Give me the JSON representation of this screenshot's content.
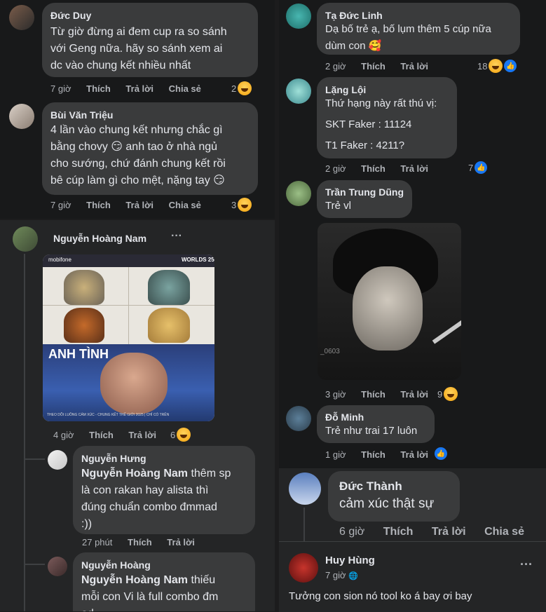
{
  "actions": {
    "like": "Thích",
    "reply": "Trả lời",
    "share": "Chia sẻ"
  },
  "left_top": [
    {
      "name": "Đức Duy",
      "lines": [
        "Từ giờ đừng ai đem cup ra so sánh",
        "với Geng nữa. hãy so sánh xem ai",
        "dc vào chung kết nhiều nhất"
      ],
      "time": "7 giờ",
      "reactions": "2"
    },
    {
      "name": "Bùi Văn Triệu",
      "lines": [
        "4 lần vào chung kết nhưng chắc gì",
        "bằng chovy 😏 anh tao ở nhà ngủ",
        "cho sướng, chứ đánh chung kết rồi",
        "bê cúp làm gì cho mệt, nặng tay 😏"
      ],
      "time": "7 giờ",
      "reactions": "3"
    }
  ],
  "left_post": {
    "name": "Nguyễn Hoàng Nam",
    "more": "···",
    "image_caption": "ANH TÌNH",
    "image_brand": "mobifone",
    "image_event": "WORLDS 25",
    "image_footer": "THEO DÕI LUỒNG CẢM XÚC - CHUNG KẾT THẾ GIỚI 2025 | CHỈ CÓ TRÊN",
    "time": "4 giờ",
    "reactions": "6"
  },
  "left_replies": [
    {
      "name": "Nguyễn Hưng",
      "mention": "Nguyễn Hoàng Nam",
      "lines": [
        " thêm sp",
        "là con rakan hay alista thì",
        "đúng chuẩn combo đmmad",
        ":))"
      ],
      "time": "27 phút"
    },
    {
      "name": "Nguyễn Hoàng",
      "mention": "Nguyễn Hoàng Nam",
      "lines": [
        " thiếu",
        "mỗi con Vi là full combo đm",
        "ad"
      ],
      "time": ""
    }
  ],
  "right_top": [
    {
      "name": "Tạ Đức Linh",
      "lines": [
        "Dạ bố trẻ ạ, bố lụm thêm 5 cúp nữa",
        "dùm con 🥰"
      ],
      "time": "2 giờ",
      "reactions": "18"
    },
    {
      "name": "Lặng Lội",
      "lines": [
        "Thứ hạng này rất thú vị:",
        "SKT Faker : 11124",
        "T1 Faker : 4211?"
      ],
      "time": "2 giờ",
      "reactions": "7"
    },
    {
      "name": "Trần Trung Dũng",
      "lines": [
        "Trẻ vl"
      ],
      "time": "3 giờ",
      "reactions": "9",
      "watermark": "_0603"
    },
    {
      "name": "Đỗ Minh",
      "lines": [
        "Trẻ như trai 17 luôn"
      ],
      "time": "1 giờ",
      "reactions": ""
    }
  ],
  "right_big": {
    "name": "Đức Thành",
    "text": "cảm xúc thật sự",
    "time": "6 giờ"
  },
  "right_post": {
    "name": "Huy Hùng",
    "time": "7 giờ",
    "text": "Tưởng con sion nó tool ko á bay ơi bay",
    "more": "···",
    "globe": "🌐"
  }
}
